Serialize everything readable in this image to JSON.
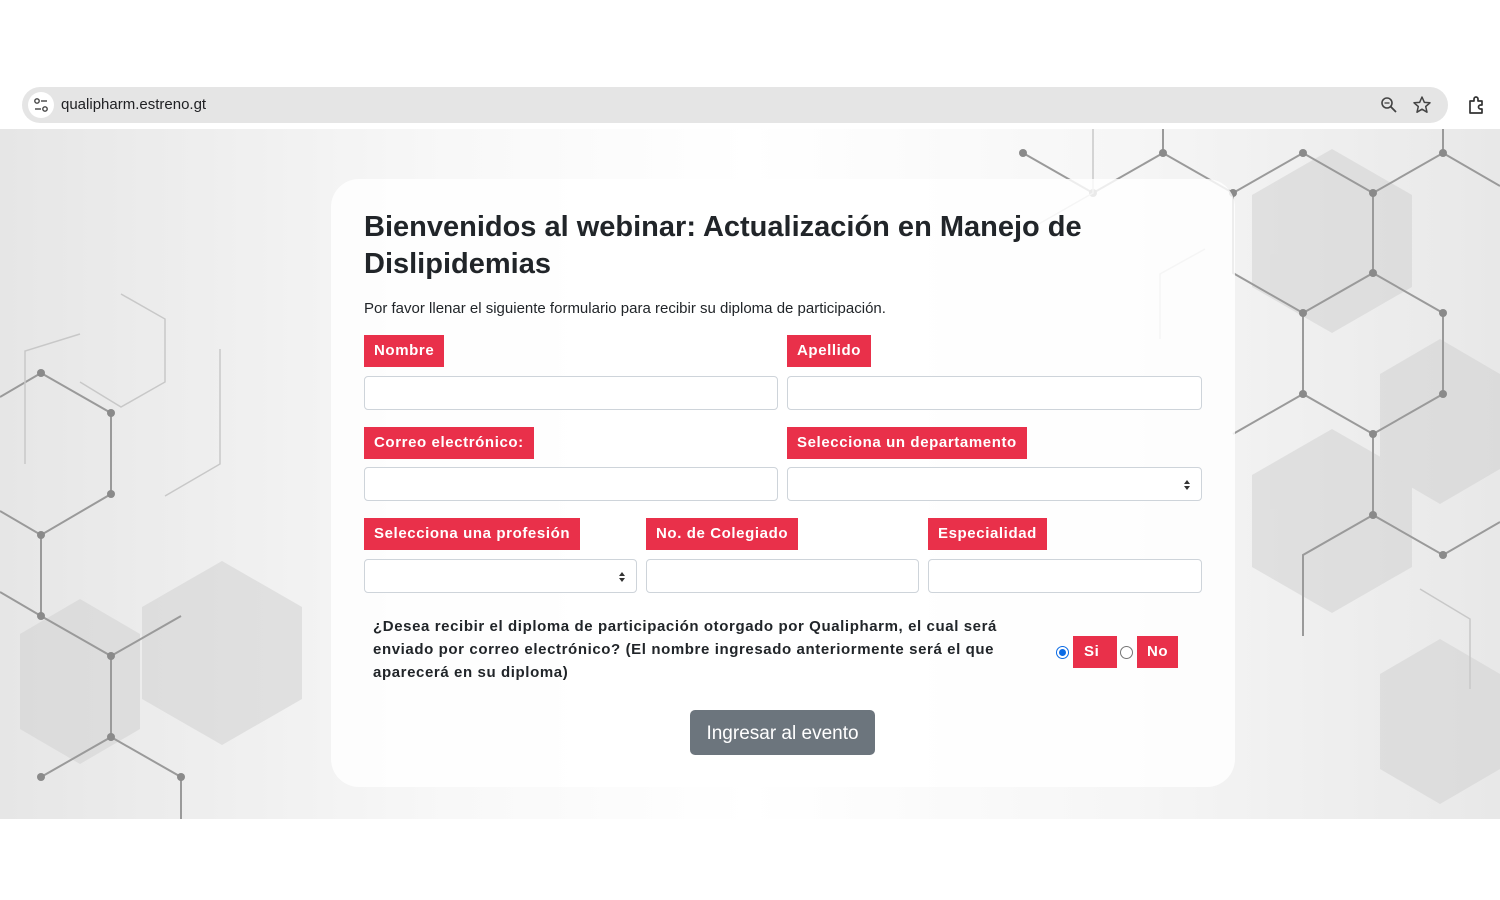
{
  "browser": {
    "url": "qualipharm.estreno.gt",
    "icons": [
      "site-info-icon",
      "zoom-icon",
      "bookmark-star-icon",
      "extensions-icon"
    ]
  },
  "page": {
    "title": "Bienvenidos al webinar: Actualización en Manejo de Dislipidemias",
    "subtitle": "Por favor llenar el siguiente formulario para recibir su diploma de participación."
  },
  "form": {
    "nombre": {
      "label": "Nombre",
      "value": ""
    },
    "apellido": {
      "label": "Apellido",
      "value": ""
    },
    "correo": {
      "label": "Correo electrónico:",
      "value": ""
    },
    "departamento": {
      "label": "Selecciona un departamento",
      "selected": ""
    },
    "profesion": {
      "label": "Selecciona una profesión",
      "selected": ""
    },
    "colegiado": {
      "label": "No. de Colegiado",
      "value": ""
    },
    "especialidad": {
      "label": "Especialidad",
      "value": ""
    },
    "diploma": {
      "question": "¿Desea recibir el diploma de participación otorgado por Qualipharm, el cual será enviado por correo electrónico? (El nombre ingresado anteriormente será el que aparecerá en su diploma)",
      "options": [
        {
          "label": "Si",
          "checked": true
        },
        {
          "label": "No",
          "checked": false
        }
      ]
    },
    "submit_label": "Ingresar al evento"
  },
  "colors": {
    "label_bg": "#e9304a",
    "button_bg": "#6c757d",
    "radio_accent": "#0b6be5"
  }
}
